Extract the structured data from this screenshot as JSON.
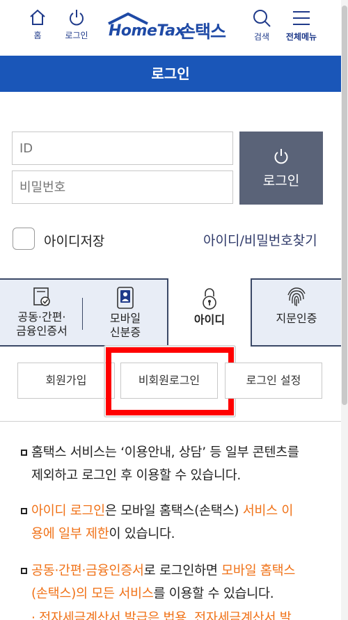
{
  "header": {
    "home_label": "홈",
    "login_label": "로그인",
    "logo_en": "HomeTax",
    "logo_ko": "손택스",
    "search_label": "검색",
    "menu_label": "전체메뉴"
  },
  "title_bar": {
    "title": "로그인"
  },
  "form": {
    "id_placeholder": "ID",
    "pw_placeholder": "비밀번호",
    "login_button": "로그인",
    "remember_label": "아이디저장",
    "find_link": "아이디/비밀번호찾기"
  },
  "tabs": {
    "cert_line1": "공동·간편·",
    "cert_line2": "금융인증서",
    "mobile_line1": "모바일",
    "mobile_line2": "신분증",
    "id_tab": "아이디",
    "fingerprint_tab": "지문인증"
  },
  "sub_buttons": {
    "signup": "회원가입",
    "guest_login": "비회원로그인",
    "login_settings": "로그인 설정"
  },
  "notices": {
    "n1_line1": "홈택스 서비스는 ‘이용안내, 상담’ 등 일부 콘텐츠를",
    "n1_line2": "제외하고 로그인 후 이용할 수 있습니다.",
    "n2_hl1": "아이디 로그인",
    "n2_text1": "은 모바일 홈택스(손택스) ",
    "n2_hl2": "서비스 이",
    "n2_hl3": "용에 일부 제한",
    "n2_text2": "이 있습니다.",
    "n3_hl1": "공동·간편·금융인증서",
    "n3_text1": "로 로그인하면 ",
    "n3_hl2": "모바일 홈택스",
    "n3_hl3": "(손택스)의 모든 서비스",
    "n3_text2": "를 이용할 수 있습니다.",
    "n4_partial": "· 전자세금계산서 발급은 법용, 전자세금계산서 발"
  },
  "colors": {
    "primary_blue": "#1a56b8",
    "login_button_bg": "#5a6378",
    "highlight_orange": "#f07218",
    "annotation_red": "#ff0000"
  },
  "icons": [
    "home-icon",
    "power-icon",
    "search-icon",
    "menu-icon",
    "certificate-icon",
    "mobile-id-icon",
    "lock-icon",
    "fingerprint-icon"
  ]
}
